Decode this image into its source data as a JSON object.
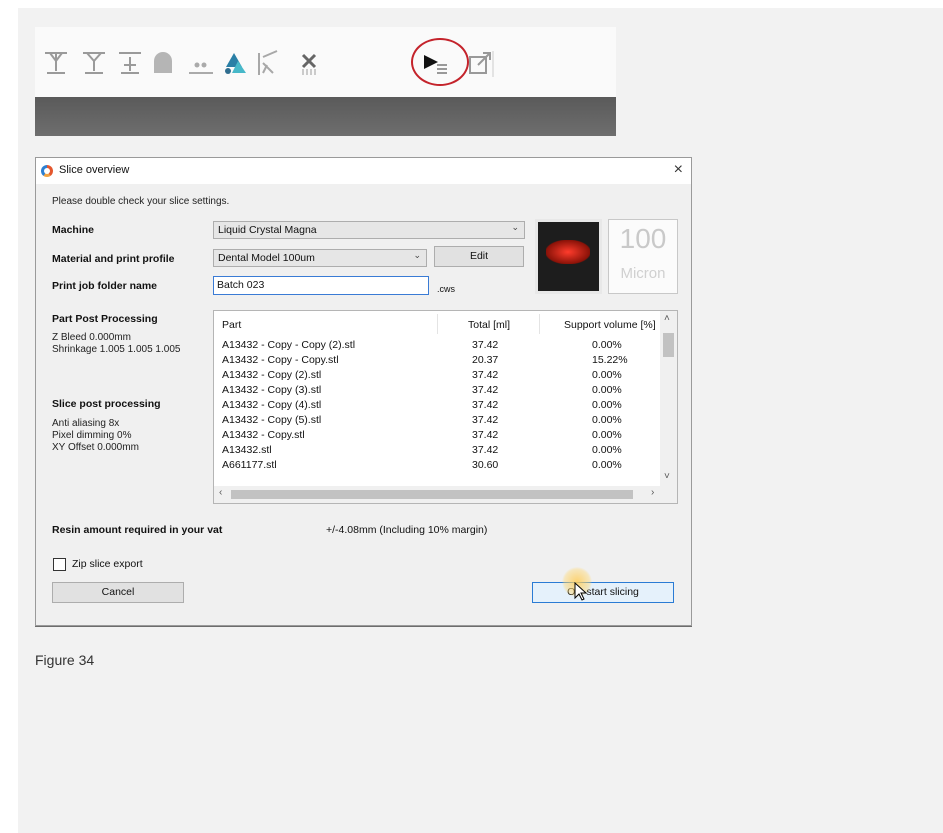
{
  "toolbar": {
    "icons": [
      "support-base-icon",
      "support-add-icon",
      "support-edit-icon",
      "arch-icon",
      "dots-icon",
      "people-icon",
      "cut-icon",
      "delete-icon",
      "slice-play-icon",
      "export-icon"
    ]
  },
  "dialog": {
    "title": "Slice overview",
    "close_label": "×",
    "instruction": "Please double check your slice settings.",
    "machine_label": "Machine",
    "machine_value": "Liquid Crystal Magna",
    "material_label": "Material and print profile",
    "material_value": "Dental Model 100um",
    "edit_label": "Edit",
    "folder_label": "Print job folder name",
    "folder_value": "Batch 023",
    "folder_ext": ".cws",
    "micron_value": "100",
    "micron_label": "Micron",
    "part_post_heading": "Part Post Processing",
    "part_post_lines": [
      "Z Bleed 0.000mm",
      "Shrinkage 1.005 1.005 1.005"
    ],
    "slice_post_heading": "Slice post processing",
    "slice_post_lines": [
      "Anti aliasing 8x",
      "Pixel dimming 0%",
      "XY Offset 0.000mm"
    ],
    "resin_label": "Resin amount required in your vat",
    "resin_value": "+/-4.08mm (Including 10% margin)",
    "zip_label": "Zip slice export",
    "zip_checked": false,
    "cancel_label": "Cancel",
    "ok_label": "Ok, start slicing"
  },
  "parts": {
    "columns": [
      "Part",
      "Total [ml]",
      "Support volume [%]"
    ],
    "rows": [
      {
        "part": "A13432 - Copy - Copy (2).stl",
        "total": "37.42",
        "support": "0.00%"
      },
      {
        "part": "A13432 - Copy - Copy.stl",
        "total": "20.37",
        "support": "15.22%"
      },
      {
        "part": "A13432 - Copy (2).stl",
        "total": "37.42",
        "support": "0.00%"
      },
      {
        "part": "A13432 - Copy (3).stl",
        "total": "37.42",
        "support": "0.00%"
      },
      {
        "part": "A13432 - Copy (4).stl",
        "total": "37.42",
        "support": "0.00%"
      },
      {
        "part": "A13432 - Copy (5).stl",
        "total": "37.42",
        "support": "0.00%"
      },
      {
        "part": "A13432 - Copy.stl",
        "total": "37.42",
        "support": "0.00%"
      },
      {
        "part": "A13432.stl",
        "total": "37.42",
        "support": "0.00%"
      },
      {
        "part": "A661177.stl",
        "total": "30.60",
        "support": "0.00%"
      }
    ]
  },
  "caption": "Figure 34",
  "colors": {
    "highlight_ring": "#c4232b",
    "input_border": "#3a7bd5"
  }
}
